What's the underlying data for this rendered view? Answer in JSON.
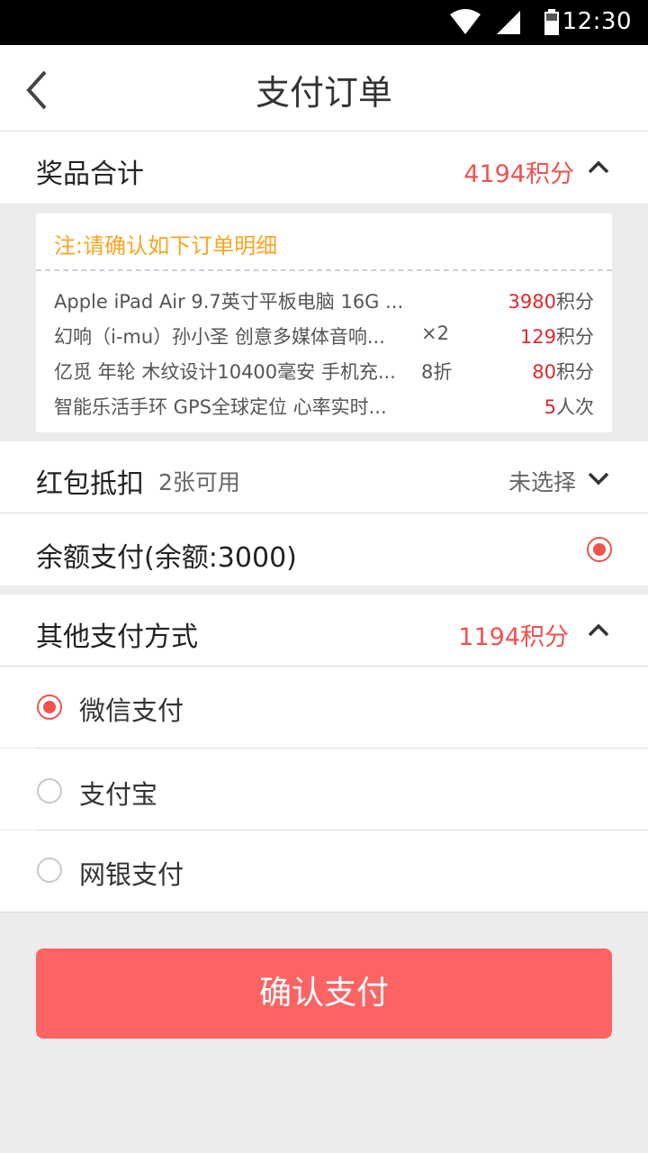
{
  "status_bar": {
    "time": "12:30",
    "icons": [
      "wifi-icon",
      "signal-icon",
      "battery-icon"
    ]
  },
  "header": {
    "title": "支付订单",
    "back_icon": "back-arrow-icon"
  },
  "prize_total": {
    "label": "奖品合计",
    "value": "4194积分",
    "expand_icon": "chevron-up-icon"
  },
  "order_summary": {
    "note": "注:请确认如下订单明细",
    "items": [
      {
        "name": "Apple iPad Air 9.7英寸平板电脑 16G ...",
        "qty": "",
        "amount_num": "3980",
        "amount_unit": "积分"
      },
      {
        "name": "幻响（i-mu）孙小圣 创意多媒体音响...",
        "qty": "×2",
        "amount_num": "129",
        "amount_unit": "积分"
      },
      {
        "name": "亿觅 年轮 木纹设计10400毫安 手机充...",
        "qty": "8折",
        "amount_num": "80",
        "amount_unit": "积分"
      },
      {
        "name": "智能乐活手环 GPS全球定位 心率实时...",
        "qty": "",
        "amount_num": "5",
        "amount_unit": "人次"
      }
    ]
  },
  "red_packet": {
    "label": "红包抵扣",
    "available": "2张可用",
    "status": "未选择",
    "expand_icon": "chevron-down-icon"
  },
  "balance_pay": {
    "label": "余额支付(余额:3000)",
    "selected": true
  },
  "other_payment": {
    "label": "其他支付方式",
    "value": "1194积分",
    "expand_icon": "chevron-up-icon",
    "methods": [
      {
        "label": "微信支付",
        "selected": true
      },
      {
        "label": "支付宝",
        "selected": false
      },
      {
        "label": "网银支付",
        "selected": false
      }
    ]
  },
  "confirm_button": {
    "label": "确认支付"
  },
  "colors": {
    "accent": "#fc6464",
    "price_red": "#e0282d",
    "note_orange": "#f5a623",
    "background": "#ececec"
  }
}
